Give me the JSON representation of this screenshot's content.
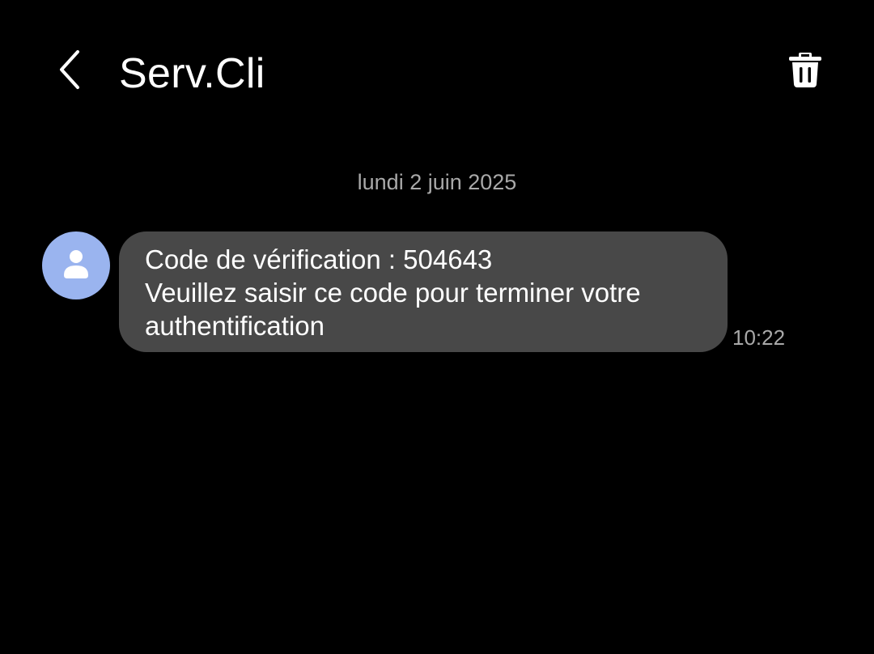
{
  "header": {
    "title": "Serv.Cli",
    "back_icon": "chevron-left-icon",
    "delete_icon": "trash-icon"
  },
  "conversation": {
    "date_separator": "lundi 2 juin 2025",
    "messages": [
      {
        "lines": [
          "Code de vérification : 504643",
          "Veuillez saisir ce code pour terminer votre",
          "authentification"
        ],
        "time": "10:22",
        "avatar_icon": "person-icon"
      }
    ]
  },
  "colors": {
    "background": "#000000",
    "bubble": "#484848",
    "avatar": "#9ab4ef",
    "secondary_text": "#a9a9a9"
  }
}
